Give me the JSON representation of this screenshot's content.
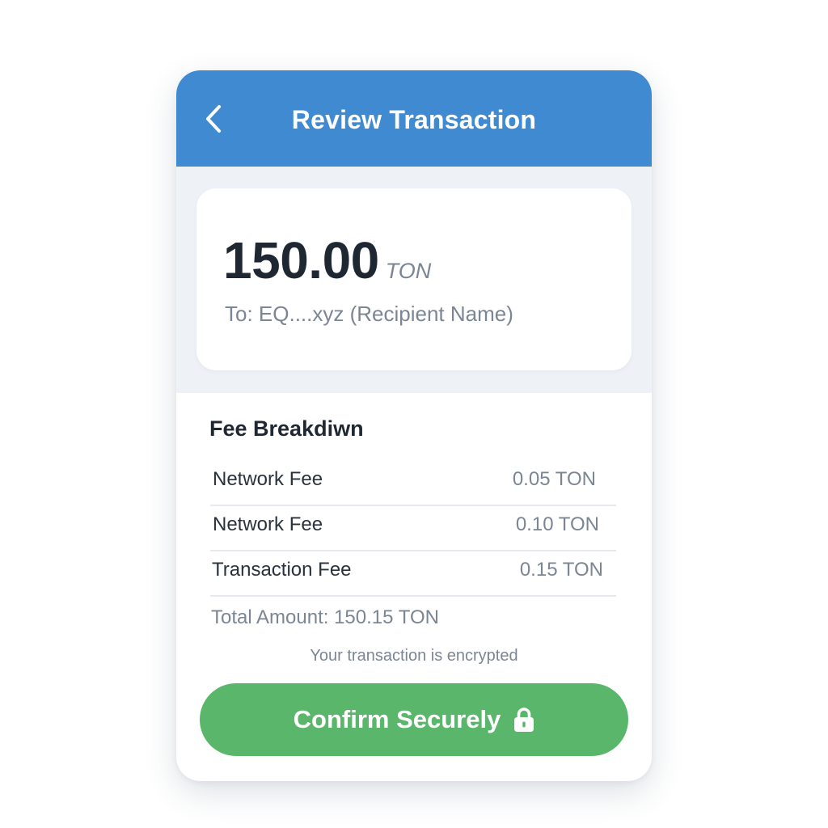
{
  "header": {
    "title": "Review Transaction",
    "back_icon": "chevron-left-icon"
  },
  "summary": {
    "amount": "150.00",
    "unit": "TON",
    "recipient": "To: EQ....xyz (Recipient Name)"
  },
  "fees": {
    "title": "Fee Breakdiwn",
    "rows": [
      {
        "label": "Network Fee",
        "value": "0.05 TON"
      },
      {
        "label": "Network Fee",
        "value": "0.10 TON"
      },
      {
        "label": "Transaction Fee",
        "value": "0.15 TON"
      }
    ],
    "total": "Total Amount: 150.15 TON"
  },
  "security_note": "Your transaction is encrypted",
  "confirm_button": {
    "label": "Confirm Securely",
    "icon": "lock-icon"
  },
  "colors": {
    "header_bg": "#3f8ad1",
    "confirm_bg": "#5ab66a",
    "summary_area_bg": "#eef2f7",
    "primary_text": "#1f2733",
    "secondary_text": "#7b8594"
  }
}
